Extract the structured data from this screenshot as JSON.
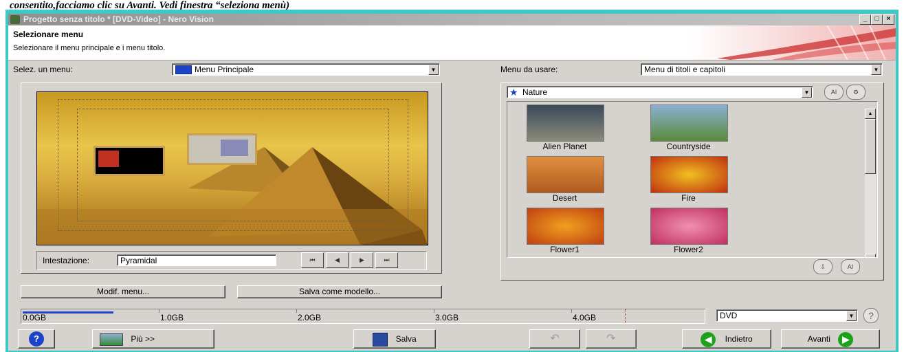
{
  "caption": "consentito,facciamo clic su Avanti. Vedi finestra “seleziona menù)",
  "window": {
    "title": "Progetto senza titolo * [DVD-Video] - Nero Vision",
    "minimize": "_",
    "maximize": "□",
    "close": "×"
  },
  "header": {
    "title": "Selezionare menu",
    "subtitle": "Selezionare il menu principale e i menu titolo."
  },
  "left": {
    "select_label": "Selez. un menu:",
    "select_value": "Menu Principale",
    "heading_label": "Intestazione:",
    "heading_value": "Pyramidal",
    "modify_button": "Modif. menu...",
    "save_template_button": "Salva come modello..."
  },
  "right": {
    "menu_label": "Menu da usare:",
    "menu_value": "Menu di titoli e capitoli",
    "category_value": "Nature",
    "templates": [
      {
        "name": "Alien Planet",
        "color": "#5a6a6a"
      },
      {
        "name": "Countryside",
        "color": "#6a8a5a"
      },
      {
        "name": "Desert",
        "color": "#c86a2a"
      },
      {
        "name": "Fire",
        "color": "#c84a1a"
      },
      {
        "name": "Flower1",
        "color": "#d85a1a"
      },
      {
        "name": "Flower2",
        "color": "#d84a7a"
      }
    ]
  },
  "capacity": {
    "ticks": [
      "0.0GB",
      "1.0GB",
      "2.0GB",
      "3.0GB",
      "4.0GB"
    ],
    "used_fraction": 0.025,
    "disc_type": "DVD"
  },
  "footer": {
    "more_button": "Più >>",
    "save_button": "Salva",
    "back_button": "Indietro",
    "next_button": "Avanti"
  },
  "colors": {
    "frame": "#3ec9c9",
    "window_bg": "#d6d3ce",
    "accent_blue": "#1d43c8",
    "nav_green": "#1ea21e"
  }
}
